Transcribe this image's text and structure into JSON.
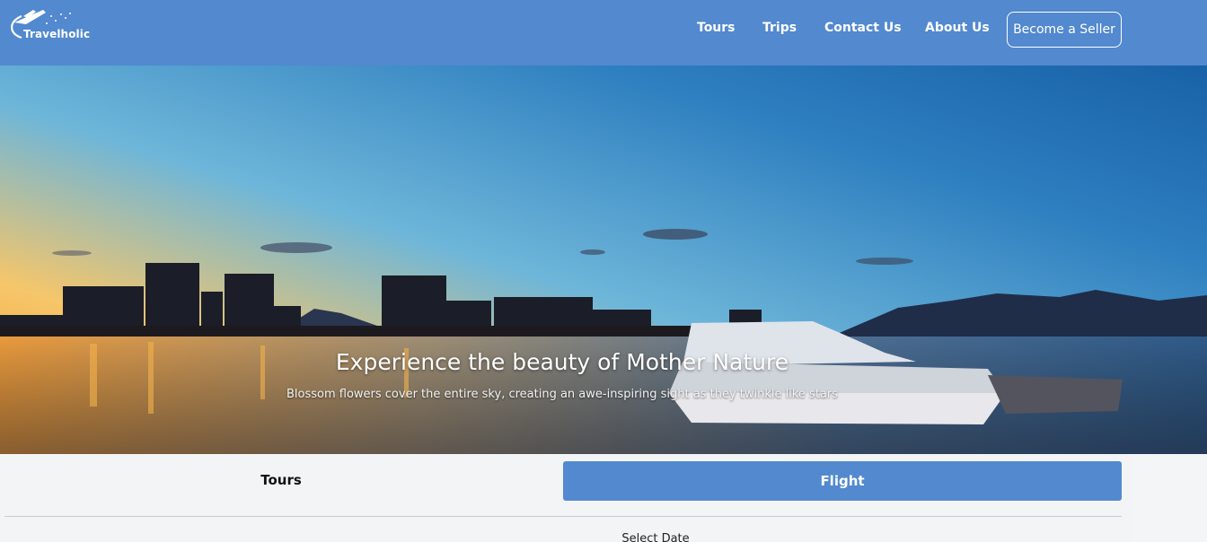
{
  "header": {
    "brand": "Travelholic",
    "nav": [
      "Tours",
      "Trips",
      "Contact Us",
      "About Us"
    ],
    "cta": "Become a Seller"
  },
  "hero": {
    "title": "Experience the beauty of Mother Nature",
    "subtitle": "Blossom flowers cover the entire sky, creating an awe-inspiring sight as they twinkle like stars"
  },
  "booking": {
    "tabs": [
      "Tours",
      "Flight"
    ],
    "active_tab": "Flight",
    "date_label": "Select Date"
  },
  "colors": {
    "header_bg": "#5289cf",
    "active_tab": "#5289cf"
  }
}
